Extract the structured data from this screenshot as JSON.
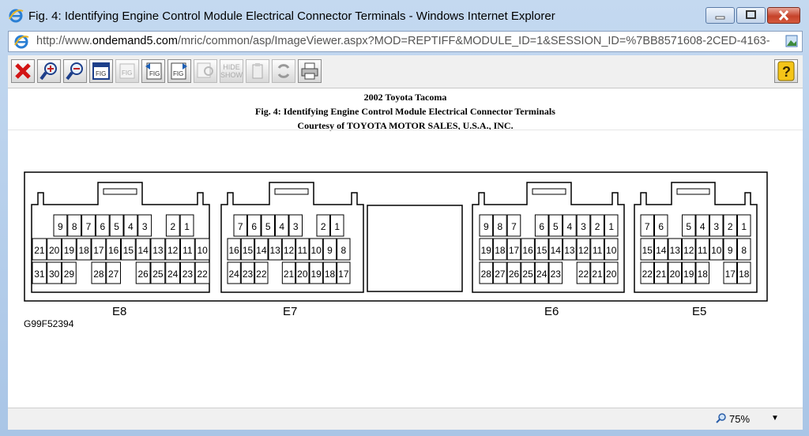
{
  "window": {
    "title": "Fig. 4: Identifying Engine Control Module Electrical Connector Terminals - Windows Internet Explorer"
  },
  "address": {
    "url_prefix": "http://www.",
    "url_domain": "ondemand5.com",
    "url_rest": "/mric/common/asp/ImageViewer.aspx?MOD=REPTIFF&MODULE_ID=1&SESSION_ID=%7BB8571608-2CED-4163-"
  },
  "toolbar": {
    "hide_show_label_1": "HIDE",
    "hide_show_label_2": "SHOW",
    "fig_label": "FIG",
    "help_label": "?"
  },
  "figure": {
    "line1": "2002 Toyota Tacoma",
    "line2": "Fig. 4: Identifying Engine Control Module Electrical Connector Terminals",
    "line3": "Courtesy of TOYOTA MOTOR SALES, U.S.A., INC.",
    "code": "G99F52394",
    "connectors": [
      {
        "name": "E8",
        "rows": [
          [
            "9",
            "8",
            "7",
            "6",
            "5",
            "4",
            "3",
            "",
            "2",
            "1"
          ],
          [
            "21",
            "20",
            "19",
            "18",
            "17",
            "16",
            "15",
            "14",
            "13",
            "12",
            "11",
            "10"
          ],
          [
            "31",
            "30",
            "29",
            "",
            "28",
            "27",
            "",
            "26",
            "25",
            "24",
            "23",
            "22"
          ]
        ]
      },
      {
        "name": "E7",
        "rows": [
          [
            "7",
            "6",
            "5",
            "4",
            "3",
            "",
            "2",
            "1"
          ],
          [
            "16",
            "15",
            "14",
            "13",
            "12",
            "11",
            "10",
            "9",
            "8"
          ],
          [
            "24",
            "23",
            "22",
            "",
            "21",
            "20",
            "19",
            "18",
            "17"
          ]
        ]
      },
      {
        "name": "E6",
        "rows": [
          [
            "9",
            "8",
            "7",
            "",
            "6",
            "5",
            "4",
            "3",
            "2",
            "1"
          ],
          [
            "19",
            "18",
            "17",
            "16",
            "15",
            "14",
            "13",
            "12",
            "11",
            "10"
          ],
          [
            "28",
            "27",
            "26",
            "25",
            "24",
            "23",
            "",
            "22",
            "21",
            "20"
          ]
        ]
      },
      {
        "name": "E5",
        "rows": [
          [
            "7",
            "6",
            "",
            "5",
            "4",
            "3",
            "2",
            "1"
          ],
          [
            "15",
            "14",
            "13",
            "12",
            "11",
            "10",
            "9",
            "8"
          ],
          [
            "22",
            "21",
            "20",
            "19",
            "18",
            "",
            "17",
            "18"
          ]
        ]
      }
    ]
  },
  "status": {
    "zoom": "75%"
  }
}
